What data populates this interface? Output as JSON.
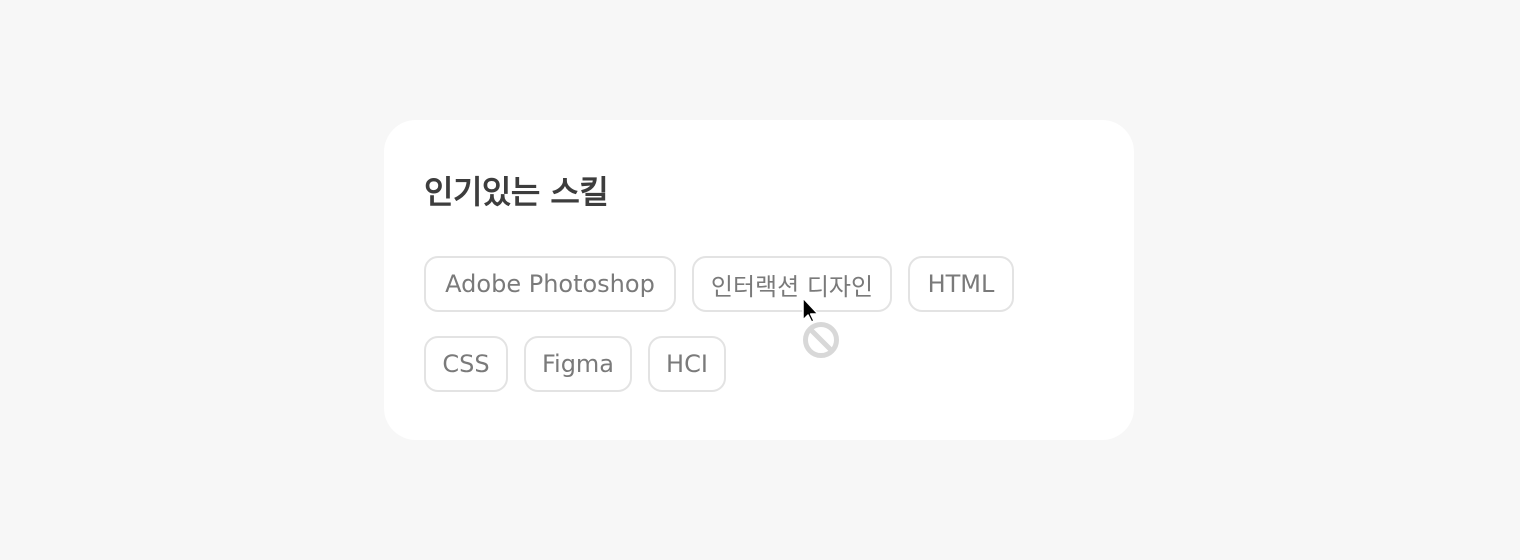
{
  "popular_skills": {
    "title": "인기있는 스킬",
    "chips": [
      {
        "label": "Adobe Photoshop"
      },
      {
        "label": "인터랙션 디자인"
      },
      {
        "label": "HTML"
      },
      {
        "label": "CSS"
      },
      {
        "label": "Figma"
      },
      {
        "label": "HCI"
      }
    ]
  },
  "cursor": {
    "type": "not-allowed",
    "icon": "not-allowed-cursor-icon"
  },
  "colors": {
    "background": "#f7f7f7",
    "card": "#ffffff",
    "title": "#3d3d3d",
    "chip_border": "#e3e3e3",
    "chip_text": "#7a7a7a"
  }
}
